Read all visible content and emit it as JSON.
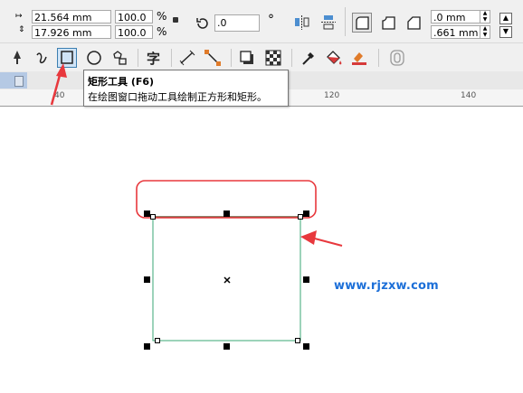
{
  "property_bar": {
    "width_value": "21.564 mm",
    "height_value": "17.926 mm",
    "scale_x": "100.0",
    "scale_y": "100.0",
    "percent_symbol": "%",
    "rotation_value": ".0",
    "degree_symbol": "°",
    "corner_radius_top": ".0 mm",
    "corner_radius_bottom": ".661 mm"
  },
  "tooltip": {
    "title": "矩形工具 (F6)",
    "description": "在绘图窗口拖动工具绘制正方形和矩形。"
  },
  "ruler": {
    "labels": [
      "40",
      "120",
      "140"
    ]
  },
  "watermark": {
    "text": "www.rjzxw.com"
  },
  "colors": {
    "annotation_red": "#e8383d",
    "rectangle_outline": "#3aa776",
    "top_edge": "#6b5a3a",
    "watermark_blue": "#1c6fd8",
    "tool_highlight": "#cfe3f6"
  },
  "icons": [
    "object-size-icon",
    "lock-ratio-icon",
    "rotate-icon",
    "mirror-horizontal-icon",
    "mirror-vertical-icon",
    "round-corner-icon",
    "scalloped-corner-icon",
    "chamfered-corner-icon",
    "shape-tool-icon",
    "freehand-tool-icon",
    "rectangle-tool-icon",
    "ellipse-tool-icon",
    "polygon-tool-icon",
    "text-tool-icon",
    "dimension-tool-icon",
    "connector-tool-icon",
    "drop-shadow-tool-icon",
    "transparency-tool-icon",
    "eyedropper-tool-icon",
    "interactive-fill-icon",
    "smart-fill-icon",
    "contour-icon"
  ]
}
